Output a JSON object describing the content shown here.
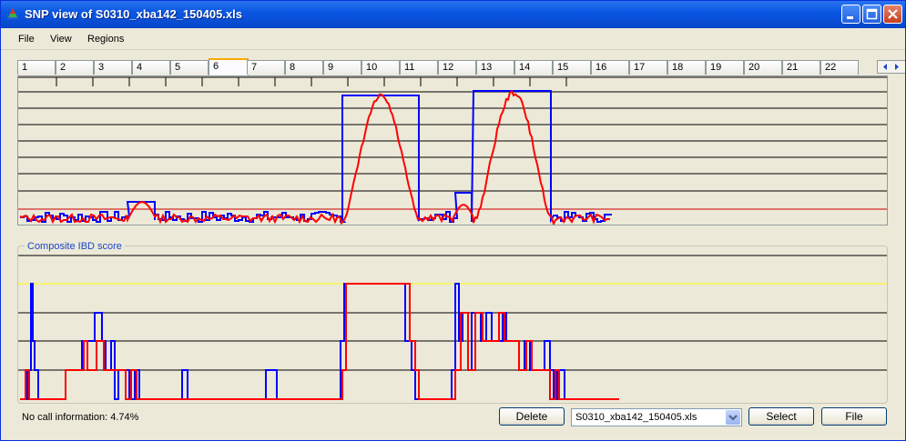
{
  "window": {
    "title": "SNP view of S0310_xba142_150405.xls"
  },
  "menu": [
    "File",
    "View",
    "Regions"
  ],
  "tabs": [
    "1",
    "2",
    "3",
    "4",
    "5",
    "6",
    "7",
    "8",
    "9",
    "10",
    "11",
    "12",
    "13",
    "14",
    "15",
    "16",
    "17",
    "18",
    "19",
    "20",
    "21",
    "22"
  ],
  "active_tab": "6",
  "composite_label": "Composite IBD score",
  "status_text": "No call information: 4.74%",
  "buttons": {
    "delete": "Delete",
    "select": "Select",
    "file": "File"
  },
  "file_combo": {
    "value": "S0310_xba142_150405.xls"
  },
  "colors": {
    "blue": "#0000ff",
    "red": "#ff0000",
    "yellow": "#ffff00",
    "accent_tab": "#f8a900",
    "title_bar": "#0a57e3"
  }
}
